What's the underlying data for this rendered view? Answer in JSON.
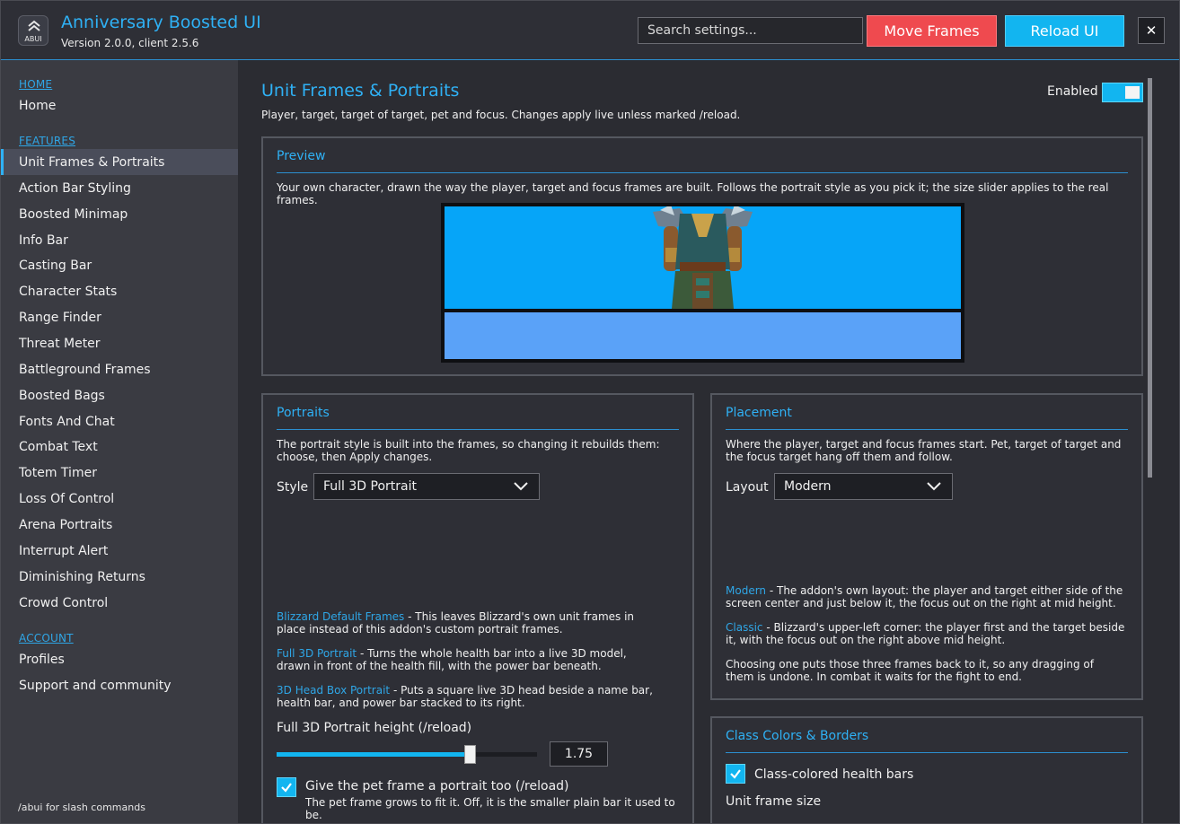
{
  "app": {
    "logo_text": "ABUI",
    "title": "Anniversary Boosted UI",
    "version": "Version 2.0.0, client 2.5.6"
  },
  "header": {
    "search_placeholder": "Search settings...",
    "move_frames_label": "Move Frames",
    "reload_label": "Reload UI",
    "close_label": "✕",
    "move_color": "#ef4a4f",
    "reload_color": "#12b5f0"
  },
  "sidebar": {
    "sections": {
      "home": "HOME",
      "features": "FEATURES",
      "account": "ACCOUNT"
    },
    "home_items": [
      "Home"
    ],
    "feature_items": [
      "Unit Frames & Portraits",
      "Action Bar Styling",
      "Boosted Minimap",
      "Info Bar",
      "Casting Bar",
      "Character Stats",
      "Range Finder",
      "Threat Meter",
      "Battleground Frames",
      "Boosted Bags",
      "Fonts And Chat",
      "Combat Text",
      "Totem Timer",
      "Loss Of Control",
      "Arena Portraits",
      "Interrupt Alert",
      "Diminishing Returns",
      "Crowd Control"
    ],
    "account_items": [
      "Profiles",
      "Support and community"
    ],
    "active_item": "Unit Frames & Portraits",
    "footer": "/abui for slash commands"
  },
  "main": {
    "title": "Unit Frames & Portraits",
    "description": "Player, target, target of target, pet and focus.  Changes apply live unless marked /reload.",
    "enabled_label": "Enabled",
    "enabled": true
  },
  "preview": {
    "title": "Preview",
    "description": "Your own character, drawn the way the player, target and focus frames are built.  Follows the portrait style as you pick it; the size slider applies to the real frames.",
    "health_color": "#06a5f8",
    "power_color": "#5aa2f8"
  },
  "portraits": {
    "title": "Portraits",
    "description": "The portrait style is built into the frames, so changing it rebuilds them: choose, then Apply changes.",
    "style_label": "Style",
    "style_value": "Full 3D Portrait",
    "options": [
      {
        "name": "Blizzard Default Frames",
        "desc": " - This leaves Blizzard's own unit frames in place instead of this addon's custom portrait frames."
      },
      {
        "name": "Full 3D Portrait",
        "desc": " - Turns the whole health bar into a live 3D model, drawn in front of the health fill, with the power bar beneath."
      },
      {
        "name": "3D Head Box Portrait",
        "desc": " - Puts a square live 3D head beside a name bar, health bar, and power bar stacked to its right."
      }
    ],
    "height_label": "Full 3D Portrait height (/reload)",
    "height_value": "1.75",
    "height_fraction": 0.74,
    "pet_checkbox_label": "Give the pet frame a portrait too (/reload)",
    "pet_checkbox_checked": true,
    "pet_checkbox_desc": "The pet frame grows to fit it.  Off, it is the smaller plain bar it used to be."
  },
  "placement": {
    "title": "Placement",
    "description": "Where the player, target and focus frames start.  Pet, target of target and the focus target hang off them and follow.",
    "layout_label": "Layout",
    "layout_value": "Modern",
    "options": [
      {
        "name": "Modern",
        "desc": " - The addon's own layout: the player and target either side of the screen center and just below it, the focus out on the right at mid height."
      },
      {
        "name": "Classic",
        "desc": " - Blizzard's upper-left corner: the player first and the target beside it, with the focus out on the right above mid height."
      }
    ],
    "note": "Choosing one puts those three frames back to it, so any dragging of them is undone.  In combat it waits for the fight to end."
  },
  "class_colors": {
    "title": "Class Colors & Borders",
    "checkbox_label": "Class-colored health bars",
    "checkbox_checked": true,
    "size_label": "Unit frame size"
  }
}
